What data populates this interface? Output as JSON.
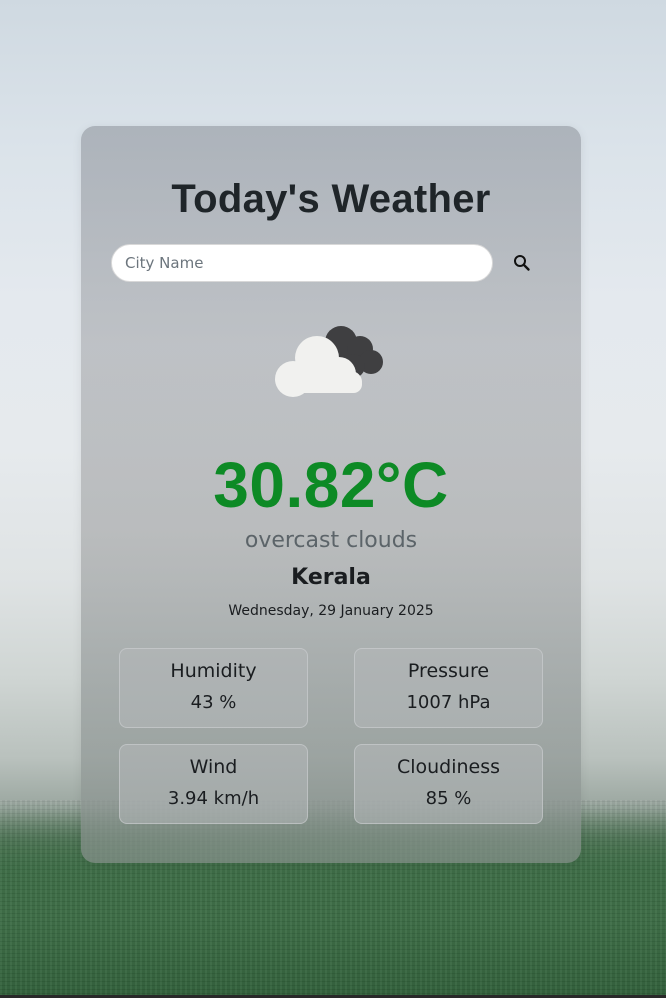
{
  "title": "Today's Weather",
  "search": {
    "placeholder": "City Name",
    "value": "",
    "icon": "search-icon"
  },
  "weather": {
    "icon": "cloudy-icon",
    "temperature": "30.82°C",
    "description": "overcast clouds",
    "city": "Kerala",
    "date": "Wednesday, 29 January 2025"
  },
  "stats": [
    {
      "label": "Humidity",
      "value": "43 %"
    },
    {
      "label": "Pressure",
      "value": "1007 hPa"
    },
    {
      "label": "Wind",
      "value": "3.94 km/h"
    },
    {
      "label": "Cloudiness",
      "value": "85 %"
    }
  ],
  "colors": {
    "temperature": "#0d8a25",
    "description": "#5c6469",
    "text": "#1a1d20"
  }
}
